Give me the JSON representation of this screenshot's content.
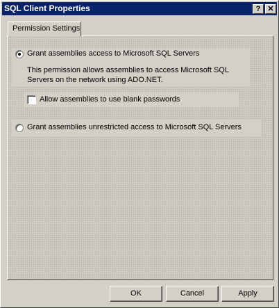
{
  "window": {
    "title": "SQL Client Properties",
    "help_label": "?",
    "close_label": "✕"
  },
  "tabs": [
    {
      "label": "Permission Settings",
      "selected": true
    }
  ],
  "options": {
    "grant_access": {
      "label": "Grant assemblies access to Microsoft SQL Servers",
      "selected": true,
      "description": "This permission allows assemblies to access Microsoft SQL Servers on the network using ADO.NET."
    },
    "blank_passwords": {
      "label": "Allow assemblies to use blank passwords",
      "checked": false
    },
    "unrestricted": {
      "label": "Grant assemblies unrestricted access to Microsoft SQL Servers",
      "selected": false
    }
  },
  "buttons": {
    "ok": "OK",
    "cancel": "Cancel",
    "apply": "Apply"
  }
}
